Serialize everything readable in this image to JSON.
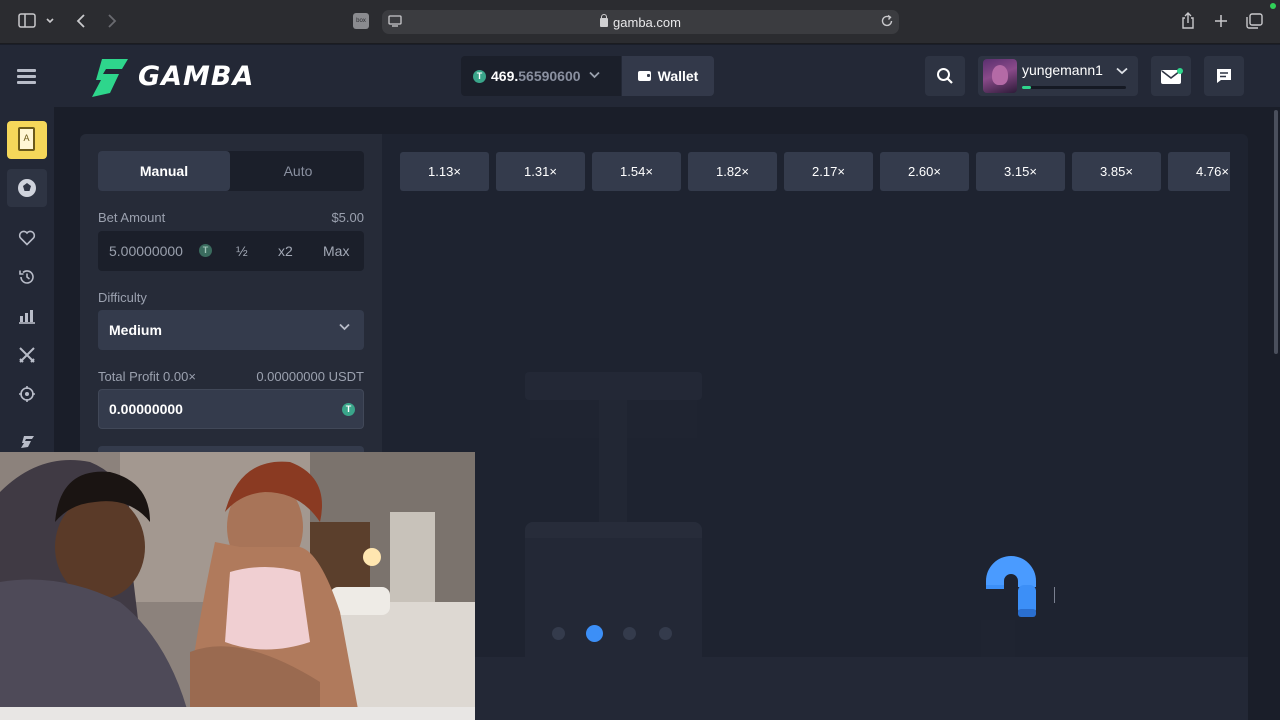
{
  "browser": {
    "url": "gamba.com",
    "tab_badge": "box"
  },
  "header": {
    "logo_text": "GAMBA",
    "balance_int": "469.",
    "balance_dec": "56590600",
    "wallet_label": "Wallet",
    "username": "yungemann1",
    "xp_progress": 0.09
  },
  "nav": {
    "items": [
      "casino",
      "sports",
      "favorites",
      "recent",
      "challenges",
      "battles",
      "rewards",
      "gamba"
    ]
  },
  "bet_panel": {
    "tabs": {
      "manual": "Manual",
      "auto": "Auto"
    },
    "bet_amount_label": "Bet Amount",
    "bet_amount_usd": "$5.00",
    "bet_amount_value": "5.00000000",
    "half_label": "½",
    "double_label": "x2",
    "max_label": "Max",
    "difficulty_label": "Difficulty",
    "difficulty_value": "Medium",
    "total_profit_label": "Total Profit 0.00×",
    "total_profit_usdt": "0.00000000 USDT",
    "total_profit_value": "0.00000000"
  },
  "multipliers": [
    "1.13×",
    "1.31×",
    "1.54×",
    "1.82×",
    "2.17×",
    "2.60×",
    "3.15×",
    "3.85×",
    "4.76×"
  ],
  "game": {
    "active_dot": 1,
    "dots": 4
  },
  "colors": {
    "accent_blue": "#3c8ff7",
    "brand_green": "#2ed68c",
    "usdt_green": "#3aa58a",
    "casino_yellow": "#f5d75a"
  }
}
